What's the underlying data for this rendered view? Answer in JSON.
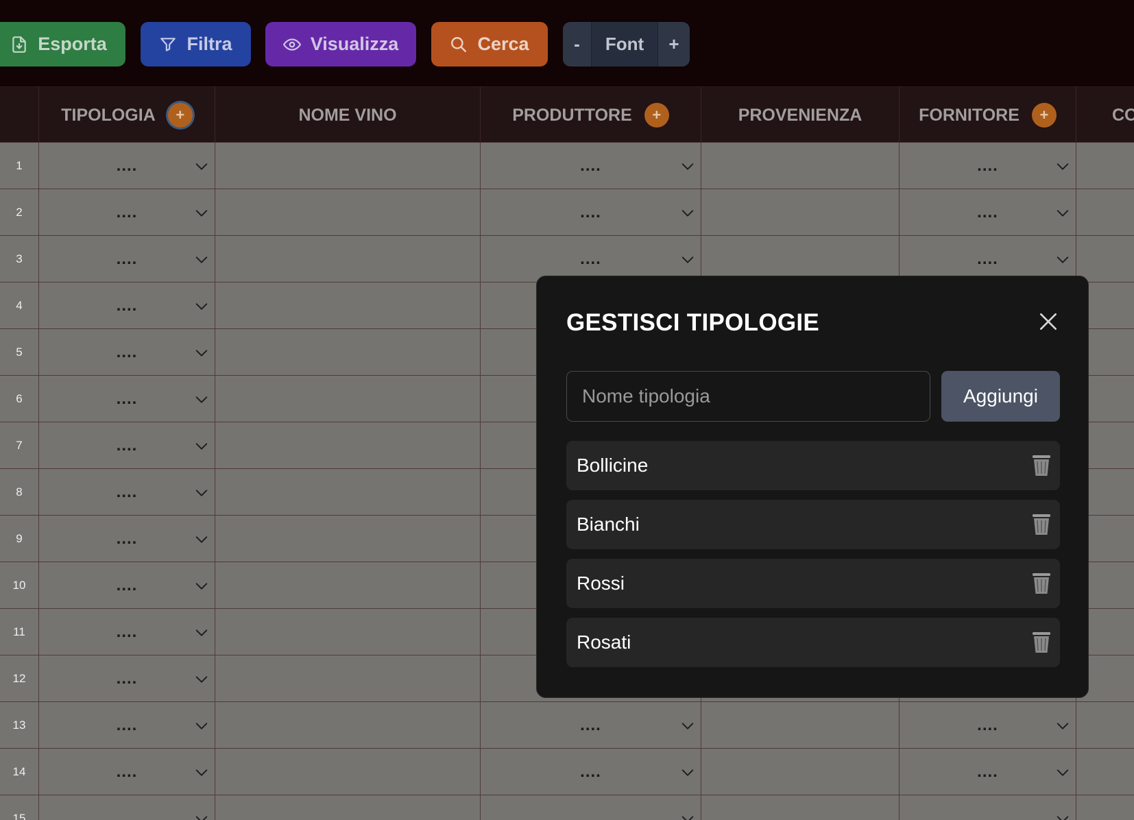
{
  "toolbar": {
    "export_label": "Esporta",
    "filter_label": "Filtra",
    "view_label": "Visualizza",
    "search_label": "Cerca",
    "font_minus": "-",
    "font_label": "Font",
    "font_plus": "+"
  },
  "table": {
    "columns": [
      {
        "label": "",
        "has_add": false
      },
      {
        "label": "TIPOLOGIA",
        "has_add": true
      },
      {
        "label": "NOME VINO",
        "has_add": false
      },
      {
        "label": "PRODUTTORE",
        "has_add": true
      },
      {
        "label": "PROVENIENZA",
        "has_add": false
      },
      {
        "label": "FORNITORE",
        "has_add": true
      },
      {
        "label": "CO",
        "has_add": false
      }
    ],
    "add_symbol": "+",
    "placeholder": "....",
    "row_numbers": [
      "1",
      "2",
      "3",
      "4",
      "5",
      "6",
      "7",
      "8",
      "9",
      "10",
      "11",
      "12",
      "13",
      "14",
      "15"
    ]
  },
  "modal": {
    "title": "GESTISCI TIPOLOGIE",
    "input_placeholder": "Nome tipologia",
    "input_value": "",
    "add_label": "Aggiungi",
    "items": [
      {
        "label": "Bollicine"
      },
      {
        "label": "Bianchi"
      },
      {
        "label": "Rossi"
      },
      {
        "label": "Rosati"
      }
    ]
  },
  "colors": {
    "export": "#2e7d43",
    "filter": "#2442a0",
    "view": "#6529a8",
    "search": "#b5511f",
    "add_accent": "#b0601d",
    "modal_bg": "#161616"
  }
}
